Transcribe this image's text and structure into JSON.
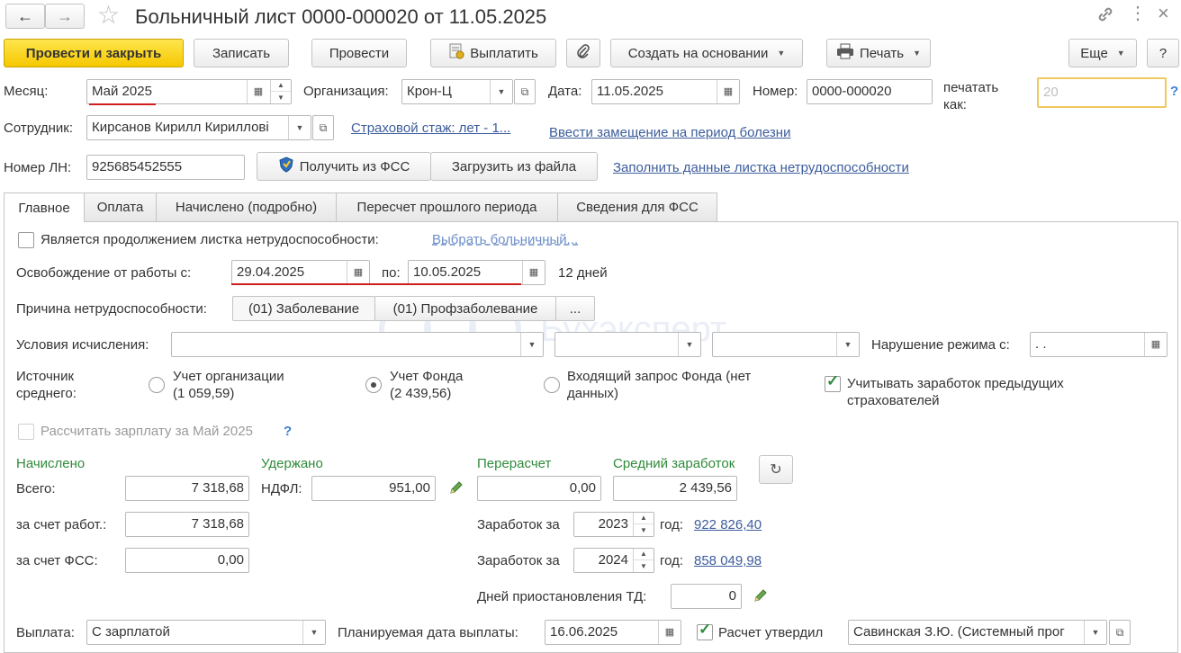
{
  "window": {
    "title": "Больничный лист 0000-000020 от 11.05.2025"
  },
  "toolbar": {
    "post_close": "Провести и закрыть",
    "save": "Записать",
    "post": "Провести",
    "pay": "Выплатить",
    "create_basis": "Создать на основании",
    "print": "Печать",
    "more": "Еще",
    "help": "?"
  },
  "header": {
    "month_label": "Месяц:",
    "month_value": "Май 2025",
    "org_label": "Организация:",
    "org_value": "Крон-Ц",
    "date_label": "Дата:",
    "date_value": "11.05.2025",
    "number_label": "Номер:",
    "number_value": "0000-000020",
    "print_as_line1": "печатать",
    "print_as_line2": "как:",
    "print_as_value": "20",
    "help_q": "?",
    "employee_label": "Сотрудник:",
    "employee_value": "Кирсанов Кирилл Кирилловi",
    "insurance_link": "Страховой стаж: лет - 1...",
    "replacement_link": "Ввести замещение на период болезни",
    "ln_label": "Номер ЛН:",
    "ln_value": "925685452555",
    "get_fss": "Получить из ФСС",
    "load_file": "Загрузить из файла",
    "fill_link": "Заполнить данные листка нетрудоспособности"
  },
  "tabs": [
    {
      "label": "Главное"
    },
    {
      "label": "Оплата"
    },
    {
      "label": "Начислено (подробно)"
    },
    {
      "label": "Пересчет прошлого периода"
    },
    {
      "label": "Сведения для ФСС"
    }
  ],
  "main": {
    "continuation_label": "Является продолжением листка нетрудоспособности:",
    "choose_sick_link": "Выбрать больничный...",
    "release_label": "Освобождение от работы с:",
    "release_from": "29.04.2025",
    "release_to_label": "по:",
    "release_to": "10.05.2025",
    "days": "12 дней",
    "reason_label": "Причина нетрудоспособности:",
    "reason_value": "(01) Заболевание",
    "reason_prof": "(01) Профзаболевание",
    "reason_more": "...",
    "conditions_label": "Условия исчисления:",
    "violation_label": "Нарушение режима с:",
    "violation_value": " .  .",
    "source_label_1": "Источник",
    "source_label_2": "среднего:",
    "src_org_1": "Учет организации",
    "src_org_2": "(1 059,59)",
    "src_fund_1": "Учет Фонда",
    "src_fund_2": "(2 439,56)",
    "src_incoming_1": "Входящий запрос Фонда (нет",
    "src_incoming_2": "данных)",
    "prev_insurers_1": "Учитывать заработок предыдущих",
    "prev_insurers_2": "страхователей",
    "calc_salary": "Рассчитать зарплату за Май 2025",
    "calc_help": "?",
    "watermark": "Бухэксперт"
  },
  "totals": {
    "accrued_title": "Начислено",
    "total_label": "Всего:",
    "total_value": "7 318,68",
    "employer_label": "за счет работ.:",
    "employer_value": "7 318,68",
    "fss_label": "за счет ФСС:",
    "fss_value": "0,00",
    "withheld_title": "Удержано",
    "ndfl_label": "НДФЛ:",
    "ndfl_value": "951,00",
    "recalc_title": "Перерасчет",
    "recalc_value": "0,00",
    "avg_title": "Средний заработок",
    "avg_value": "2 439,56",
    "earnings_label": "Заработок за",
    "year1": "2023",
    "year_suffix": "год:",
    "year1_amount": "922 826,40",
    "year2": "2024",
    "year2_amount": "858 049,98",
    "suspension_label": "Дней приостановления ТД:",
    "suspension_value": "0"
  },
  "footer": {
    "payout_label": "Выплата:",
    "payout_value": "С зарплатой",
    "planned_label": "Планируемая дата выплаты:",
    "planned_value": "16.06.2025",
    "approved_label": "Расчет утвердил",
    "approver_value": "Савинская З.Ю. (Системный прог"
  },
  "colors": {
    "accent_yellow": "#f5c800",
    "link_blue": "#3d5d9c",
    "green_text": "#2f8a3a",
    "highlight_red": "#d01d1d",
    "focus_border": "#f0c860"
  }
}
